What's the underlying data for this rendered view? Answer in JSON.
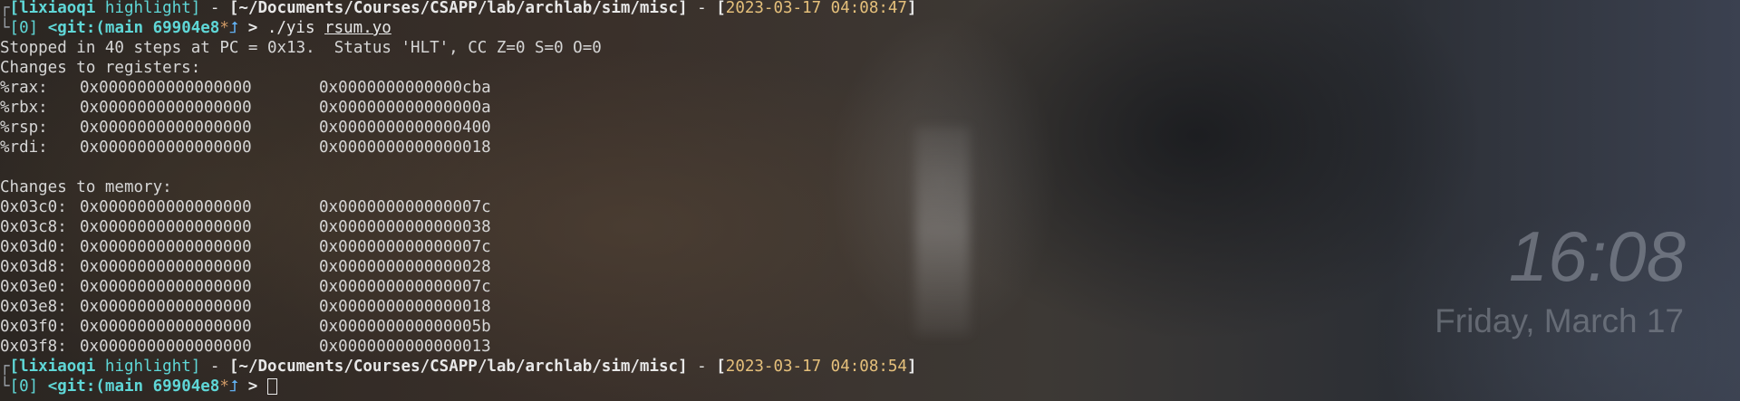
{
  "prompt1": {
    "tree_top": "┌",
    "user": "[lixiaoqi",
    "host": " highlight]",
    "sep1": " - ",
    "path": "[~/Documents/Courses/CSAPP/lab/archlab/sim/misc]",
    "sep2": " - ",
    "lbr": "[",
    "timestamp": "2023-03-17 04:08:47",
    "rbr": "]",
    "tree_bottom": "└",
    "status": "[0]",
    "git": " <git:(main 69904e8",
    "dirty": "*",
    "arrow": " > ",
    "command": "./yis ",
    "arg": "rsum.yo"
  },
  "output": {
    "stopped": "Stopped in 40 steps at PC = 0x13.  Status 'HLT', CC Z=0 S=0 O=0",
    "reg_header": "Changes to registers:",
    "registers": [
      {
        "name": "%rax:",
        "old": "0x0000000000000000",
        "new": "0x0000000000000cba"
      },
      {
        "name": "%rbx:",
        "old": "0x0000000000000000",
        "new": "0x000000000000000a"
      },
      {
        "name": "%rsp:",
        "old": "0x0000000000000000",
        "new": "0x0000000000000400"
      },
      {
        "name": "%rdi:",
        "old": "0x0000000000000000",
        "new": "0x0000000000000018"
      }
    ],
    "mem_header": "Changes to memory:",
    "memory": [
      {
        "addr": "0x03c0:",
        "old": "0x0000000000000000",
        "new": "0x000000000000007c"
      },
      {
        "addr": "0x03c8:",
        "old": "0x0000000000000000",
        "new": "0x0000000000000038"
      },
      {
        "addr": "0x03d0:",
        "old": "0x0000000000000000",
        "new": "0x000000000000007c"
      },
      {
        "addr": "0x03d8:",
        "old": "0x0000000000000000",
        "new": "0x0000000000000028"
      },
      {
        "addr": "0x03e0:",
        "old": "0x0000000000000000",
        "new": "0x000000000000007c"
      },
      {
        "addr": "0x03e8:",
        "old": "0x0000000000000000",
        "new": "0x0000000000000018"
      },
      {
        "addr": "0x03f0:",
        "old": "0x0000000000000000",
        "new": "0x000000000000005b"
      },
      {
        "addr": "0x03f8:",
        "old": "0x0000000000000000",
        "new": "0x0000000000000013"
      }
    ]
  },
  "prompt2": {
    "tree_top": "┌",
    "user": "[lixiaoqi",
    "host": " highlight]",
    "sep1": " - ",
    "path": "[~/Documents/Courses/CSAPP/lab/archlab/sim/misc]",
    "sep2": " - ",
    "lbr": "[",
    "timestamp": "2023-03-17 04:08:54",
    "rbr": "]",
    "tree_bottom": "└",
    "status": "[0]",
    "git": " <git:(main 69904e8",
    "dirty": "*",
    "arrow": " > "
  },
  "icons": {
    "git_branch_icon": "⮥"
  },
  "clock": {
    "time": "16:08",
    "date": "Friday, March 17"
  }
}
